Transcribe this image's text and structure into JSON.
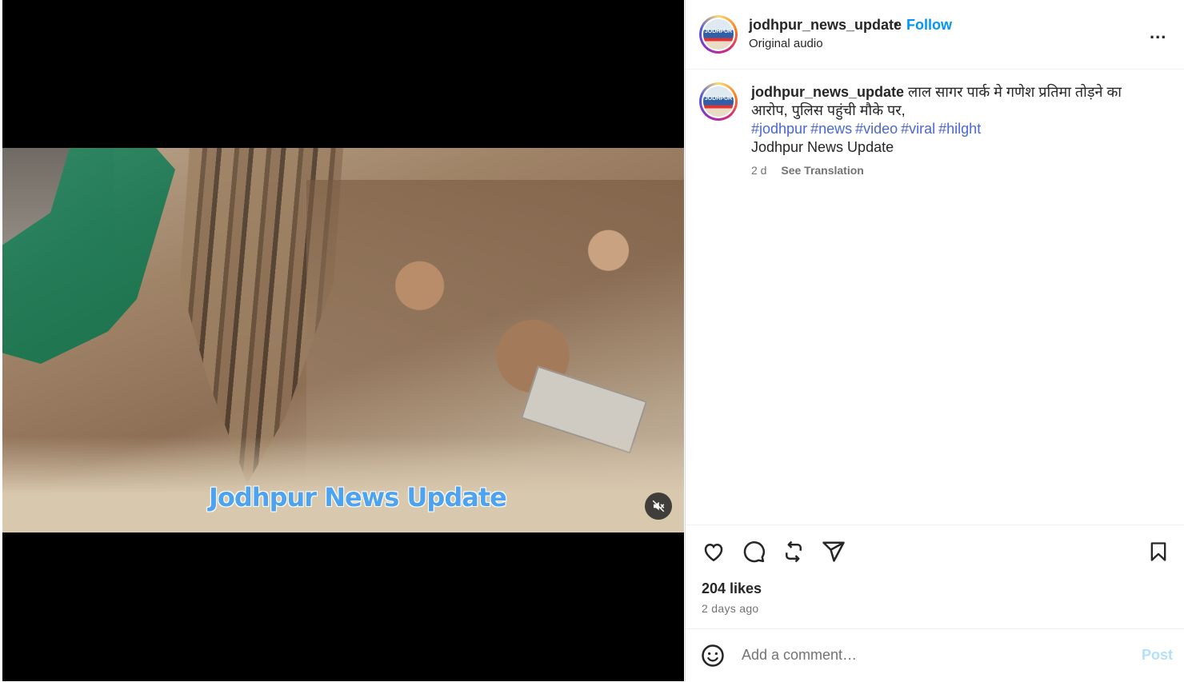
{
  "media": {
    "watermark": "Jodhpur News Update",
    "mute_icon": "speaker-muted-icon"
  },
  "header": {
    "username": "jodhpur_news_update",
    "separator": "•",
    "follow_label": "Follow",
    "audio_label": "Original audio",
    "more_label": "...",
    "avatar_text": "JODHPUR"
  },
  "caption": {
    "username": "jodhpur_news_update",
    "text": "लाल सागर पार्क मे गणेश प्रतिमा तोड़ने का आरोप, पुलिस पहुंची मौके पर,",
    "hashtags": [
      "#jodhpur",
      "#news",
      "#video",
      "#viral",
      "#hilght"
    ],
    "line": "Jodhpur News Update",
    "time": "2 d",
    "see_translation": "See Translation"
  },
  "actions": {
    "icons": [
      "heart-icon",
      "comment-icon",
      "repost-icon",
      "share-icon",
      "bookmark-icon"
    ],
    "likes": "204 likes",
    "posted": "2 days ago"
  },
  "comment": {
    "emoji_icon": "emoji-icon",
    "placeholder": "Add a comment…",
    "post_label": "Post"
  },
  "colors": {
    "accent": "#0095f6",
    "post_disabled": "#b2dffc",
    "hashtag": "#4a67d6",
    "muted_text": "#737373"
  }
}
